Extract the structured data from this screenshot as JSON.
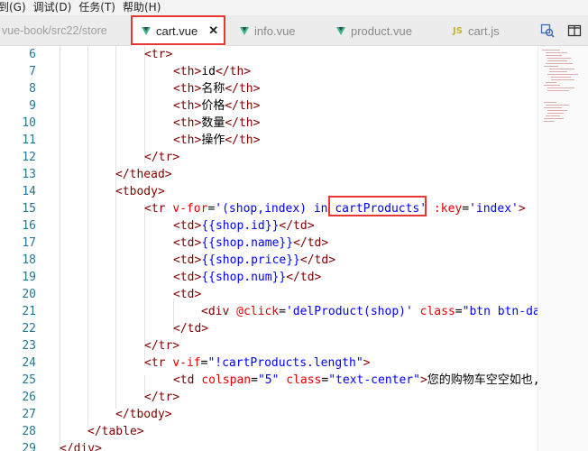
{
  "menu": {
    "items": [
      "到(G)",
      "调试(D)",
      "任务(T)",
      "帮助(H)"
    ]
  },
  "tabs": {
    "breadcrumb": "vue-book/src22/store",
    "items": [
      {
        "label": "cart.vue",
        "icon": "vue-icon",
        "active": true
      },
      {
        "label": "info.vue",
        "icon": "vue-icon",
        "active": false
      },
      {
        "label": "product.vue",
        "icon": "vue-icon",
        "active": false
      },
      {
        "label": "cart.js",
        "icon": "js-icon",
        "active": false
      }
    ],
    "close_glyph": "✕",
    "js_badge": "JS",
    "right_icons": [
      "split-compare-icon",
      "split-editor-icon"
    ]
  },
  "editor": {
    "first_line": 6,
    "lines": [
      {
        "n": "6",
        "html": "<span class='t-tag'>&lt;tr&gt;</span>"
      },
      {
        "n": "7",
        "html": "<span class='t-tag'>&lt;th&gt;</span><span class='t-txt'>id</span><span class='t-tag'>&lt;/th&gt;</span>"
      },
      {
        "n": "8",
        "html": "<span class='t-tag'>&lt;th&gt;</span><span class='t-txt'>名称</span><span class='t-tag'>&lt;/th&gt;</span>"
      },
      {
        "n": "9",
        "html": "<span class='t-tag'>&lt;th&gt;</span><span class='t-txt'>价格</span><span class='t-tag'>&lt;/th&gt;</span>"
      },
      {
        "n": "10",
        "html": "<span class='t-tag'>&lt;th&gt;</span><span class='t-txt'>数量</span><span class='t-tag'>&lt;/th&gt;</span>"
      },
      {
        "n": "11",
        "html": "<span class='t-tag'>&lt;th&gt;</span><span class='t-txt'>操作</span><span class='t-tag'>&lt;/th&gt;</span>"
      },
      {
        "n": "12",
        "html": "<span class='t-tag'>&lt;/tr&gt;</span>"
      },
      {
        "n": "13",
        "html": "<span class='t-tag'>&lt;/thead&gt;</span>"
      },
      {
        "n": "14",
        "html": "<span class='t-tag'>&lt;tbody&gt;</span>"
      },
      {
        "n": "15",
        "html": "<span class='t-tag'>&lt;tr </span><span class='t-attr'>v-for</span><span class='t-txt'>=</span><span class='t-str'>'(shop,index) </span><span class='t-kw'>in</span><span class='t-str'> cartProducts'</span><span class='t-attr'> :key</span><span class='t-txt'>=</span><span class='t-str'>'index'</span><span class='t-tag'>&gt;</span>"
      },
      {
        "n": "16",
        "html": "<span class='t-tag'>&lt;td&gt;</span><span class='t-str'>{{shop.id}}</span><span class='t-tag'>&lt;/td&gt;</span>"
      },
      {
        "n": "17",
        "html": "<span class='t-tag'>&lt;td&gt;</span><span class='t-str'>{{shop.name}}</span><span class='t-tag'>&lt;/td&gt;</span>"
      },
      {
        "n": "18",
        "html": "<span class='t-tag'>&lt;td&gt;</span><span class='t-str'>{{shop.price}}</span><span class='t-tag'>&lt;/td&gt;</span>"
      },
      {
        "n": "19",
        "html": "<span class='t-tag'>&lt;td&gt;</span><span class='t-str'>{{shop.num}}</span><span class='t-tag'>&lt;/td&gt;</span>"
      },
      {
        "n": "20",
        "html": "<span class='t-tag'>&lt;td&gt;</span>"
      },
      {
        "n": "21",
        "html": "<span class='t-tag'>&lt;div </span><span class='t-attr'>@click</span><span class='t-txt'>=</span><span class='t-str'>'delProduct(shop)'</span><span class='t-attr'> class</span><span class='t-txt'>=</span><span class='t-str'>\"btn btn-dan</span>"
      },
      {
        "n": "22",
        "html": "<span class='t-tag'>&lt;/td&gt;</span>"
      },
      {
        "n": "23",
        "html": "<span class='t-tag'>&lt;/tr&gt;</span>"
      },
      {
        "n": "24",
        "html": "<span class='t-tag'>&lt;tr </span><span class='t-attr'>v-if</span><span class='t-txt'>=</span><span class='t-str'>\"!cartProducts.length\"</span><span class='t-tag'>&gt;</span>"
      },
      {
        "n": "25",
        "html": "<span class='t-tag'>&lt;td </span><span class='t-attr'>colspan</span><span class='t-txt'>=</span><span class='t-str'>\"5\"</span><span class='t-attr'> class</span><span class='t-txt'>=</span><span class='t-str'>\"text-center\"</span><span class='t-tag'>&gt;</span><span class='t-txt'>您的购物车空空如也,</span>"
      },
      {
        "n": "26",
        "html": "<span class='t-tag'>&lt;/tr&gt;</span>"
      },
      {
        "n": "27",
        "html": "<span class='t-tag'>&lt;/tbody&gt;</span>"
      },
      {
        "n": "28",
        "html": "<span class='t-tag'>&lt;/table&gt;</span>"
      },
      {
        "n": "29",
        "html": "<span class='t-tag'>&lt;/div&gt;</span>"
      }
    ],
    "highlighted_token": "cartProducts'"
  },
  "colors": {
    "tag": "#800000",
    "attribute": "#e50000",
    "string": "#0000ff",
    "line_number": "#237893",
    "highlight_box": "#e53935",
    "vue_green": "#41b883"
  }
}
